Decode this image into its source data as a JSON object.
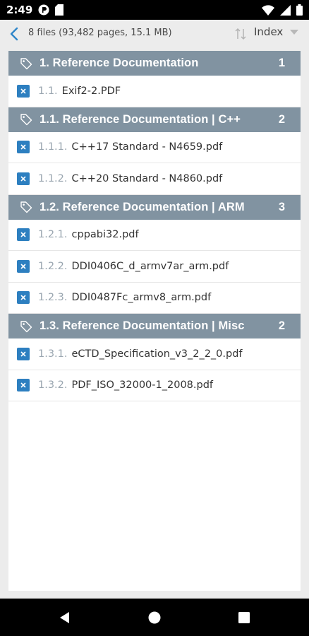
{
  "status": {
    "time": "2:49"
  },
  "toolbar": {
    "summary": "8 files (93,482 pages, 15.1 MB)",
    "sort_label": "Index"
  },
  "groups": [
    {
      "title": "1. Reference Documentation",
      "count": "1",
      "files": [
        {
          "num": "1.1.",
          "name": "Exif2-2.PDF"
        }
      ]
    },
    {
      "title": "1.1. Reference Documentation | C++",
      "count": "2",
      "files": [
        {
          "num": "1.1.1.",
          "name": "C++17 Standard - N4659.pdf"
        },
        {
          "num": "1.1.2.",
          "name": "C++20 Standard - N4860.pdf"
        }
      ]
    },
    {
      "title": "1.2. Reference Documentation | ARM",
      "count": "3",
      "files": [
        {
          "num": "1.2.1.",
          "name": "cppabi32.pdf"
        },
        {
          "num": "1.2.2.",
          "name": "DDI0406C_d_armv7ar_arm.pdf"
        },
        {
          "num": "1.2.3.",
          "name": "DDI0487Fc_armv8_arm.pdf"
        }
      ]
    },
    {
      "title": "1.3. Reference Documentation | Misc",
      "count": "2",
      "files": [
        {
          "num": "1.3.1.",
          "name": "eCTD_Specification_v3_2_2_0.pdf"
        },
        {
          "num": "1.3.2.",
          "name": "PDF_ISO_32000-1_2008.pdf"
        }
      ]
    }
  ],
  "icons": {
    "back": "chevron-left-icon",
    "sort": "sort-arrows-icon",
    "dropdown": "triangle-down-icon",
    "tag": "tag-icon",
    "document": "pdf-document-icon"
  },
  "colors": {
    "header": "#8193a1",
    "accent": "#2f86c9",
    "doc_icon": "#2d7fc0"
  }
}
